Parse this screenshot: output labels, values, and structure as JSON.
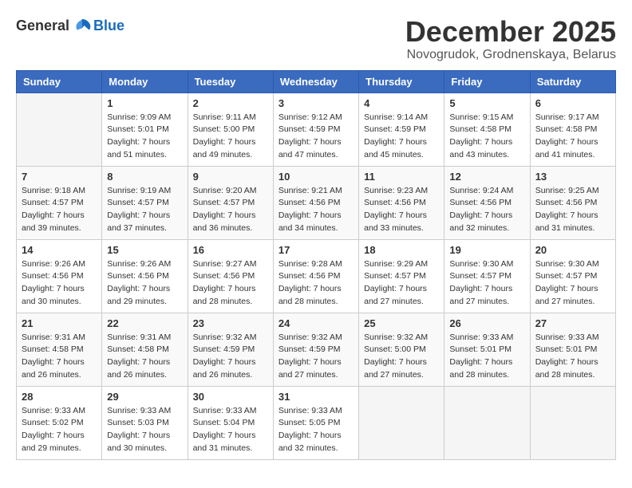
{
  "logo": {
    "general": "General",
    "blue": "Blue"
  },
  "header": {
    "month": "December 2025",
    "location": "Novogrudok, Grodnenskaya, Belarus"
  },
  "weekdays": [
    "Sunday",
    "Monday",
    "Tuesday",
    "Wednesday",
    "Thursday",
    "Friday",
    "Saturday"
  ],
  "weeks": [
    [
      {
        "day": "",
        "sunrise": "",
        "sunset": "",
        "daylight": ""
      },
      {
        "day": "1",
        "sunrise": "Sunrise: 9:09 AM",
        "sunset": "Sunset: 5:01 PM",
        "daylight": "Daylight: 7 hours and 51 minutes."
      },
      {
        "day": "2",
        "sunrise": "Sunrise: 9:11 AM",
        "sunset": "Sunset: 5:00 PM",
        "daylight": "Daylight: 7 hours and 49 minutes."
      },
      {
        "day": "3",
        "sunrise": "Sunrise: 9:12 AM",
        "sunset": "Sunset: 4:59 PM",
        "daylight": "Daylight: 7 hours and 47 minutes."
      },
      {
        "day": "4",
        "sunrise": "Sunrise: 9:14 AM",
        "sunset": "Sunset: 4:59 PM",
        "daylight": "Daylight: 7 hours and 45 minutes."
      },
      {
        "day": "5",
        "sunrise": "Sunrise: 9:15 AM",
        "sunset": "Sunset: 4:58 PM",
        "daylight": "Daylight: 7 hours and 43 minutes."
      },
      {
        "day": "6",
        "sunrise": "Sunrise: 9:17 AM",
        "sunset": "Sunset: 4:58 PM",
        "daylight": "Daylight: 7 hours and 41 minutes."
      }
    ],
    [
      {
        "day": "7",
        "sunrise": "Sunrise: 9:18 AM",
        "sunset": "Sunset: 4:57 PM",
        "daylight": "Daylight: 7 hours and 39 minutes."
      },
      {
        "day": "8",
        "sunrise": "Sunrise: 9:19 AM",
        "sunset": "Sunset: 4:57 PM",
        "daylight": "Daylight: 7 hours and 37 minutes."
      },
      {
        "day": "9",
        "sunrise": "Sunrise: 9:20 AM",
        "sunset": "Sunset: 4:57 PM",
        "daylight": "Daylight: 7 hours and 36 minutes."
      },
      {
        "day": "10",
        "sunrise": "Sunrise: 9:21 AM",
        "sunset": "Sunset: 4:56 PM",
        "daylight": "Daylight: 7 hours and 34 minutes."
      },
      {
        "day": "11",
        "sunrise": "Sunrise: 9:23 AM",
        "sunset": "Sunset: 4:56 PM",
        "daylight": "Daylight: 7 hours and 33 minutes."
      },
      {
        "day": "12",
        "sunrise": "Sunrise: 9:24 AM",
        "sunset": "Sunset: 4:56 PM",
        "daylight": "Daylight: 7 hours and 32 minutes."
      },
      {
        "day": "13",
        "sunrise": "Sunrise: 9:25 AM",
        "sunset": "Sunset: 4:56 PM",
        "daylight": "Daylight: 7 hours and 31 minutes."
      }
    ],
    [
      {
        "day": "14",
        "sunrise": "Sunrise: 9:26 AM",
        "sunset": "Sunset: 4:56 PM",
        "daylight": "Daylight: 7 hours and 30 minutes."
      },
      {
        "day": "15",
        "sunrise": "Sunrise: 9:26 AM",
        "sunset": "Sunset: 4:56 PM",
        "daylight": "Daylight: 7 hours and 29 minutes."
      },
      {
        "day": "16",
        "sunrise": "Sunrise: 9:27 AM",
        "sunset": "Sunset: 4:56 PM",
        "daylight": "Daylight: 7 hours and 28 minutes."
      },
      {
        "day": "17",
        "sunrise": "Sunrise: 9:28 AM",
        "sunset": "Sunset: 4:56 PM",
        "daylight": "Daylight: 7 hours and 28 minutes."
      },
      {
        "day": "18",
        "sunrise": "Sunrise: 9:29 AM",
        "sunset": "Sunset: 4:57 PM",
        "daylight": "Daylight: 7 hours and 27 minutes."
      },
      {
        "day": "19",
        "sunrise": "Sunrise: 9:30 AM",
        "sunset": "Sunset: 4:57 PM",
        "daylight": "Daylight: 7 hours and 27 minutes."
      },
      {
        "day": "20",
        "sunrise": "Sunrise: 9:30 AM",
        "sunset": "Sunset: 4:57 PM",
        "daylight": "Daylight: 7 hours and 27 minutes."
      }
    ],
    [
      {
        "day": "21",
        "sunrise": "Sunrise: 9:31 AM",
        "sunset": "Sunset: 4:58 PM",
        "daylight": "Daylight: 7 hours and 26 minutes."
      },
      {
        "day": "22",
        "sunrise": "Sunrise: 9:31 AM",
        "sunset": "Sunset: 4:58 PM",
        "daylight": "Daylight: 7 hours and 26 minutes."
      },
      {
        "day": "23",
        "sunrise": "Sunrise: 9:32 AM",
        "sunset": "Sunset: 4:59 PM",
        "daylight": "Daylight: 7 hours and 26 minutes."
      },
      {
        "day": "24",
        "sunrise": "Sunrise: 9:32 AM",
        "sunset": "Sunset: 4:59 PM",
        "daylight": "Daylight: 7 hours and 27 minutes."
      },
      {
        "day": "25",
        "sunrise": "Sunrise: 9:32 AM",
        "sunset": "Sunset: 5:00 PM",
        "daylight": "Daylight: 7 hours and 27 minutes."
      },
      {
        "day": "26",
        "sunrise": "Sunrise: 9:33 AM",
        "sunset": "Sunset: 5:01 PM",
        "daylight": "Daylight: 7 hours and 28 minutes."
      },
      {
        "day": "27",
        "sunrise": "Sunrise: 9:33 AM",
        "sunset": "Sunset: 5:01 PM",
        "daylight": "Daylight: 7 hours and 28 minutes."
      }
    ],
    [
      {
        "day": "28",
        "sunrise": "Sunrise: 9:33 AM",
        "sunset": "Sunset: 5:02 PM",
        "daylight": "Daylight: 7 hours and 29 minutes."
      },
      {
        "day": "29",
        "sunrise": "Sunrise: 9:33 AM",
        "sunset": "Sunset: 5:03 PM",
        "daylight": "Daylight: 7 hours and 30 minutes."
      },
      {
        "day": "30",
        "sunrise": "Sunrise: 9:33 AM",
        "sunset": "Sunset: 5:04 PM",
        "daylight": "Daylight: 7 hours and 31 minutes."
      },
      {
        "day": "31",
        "sunrise": "Sunrise: 9:33 AM",
        "sunset": "Sunset: 5:05 PM",
        "daylight": "Daylight: 7 hours and 32 minutes."
      },
      {
        "day": "",
        "sunrise": "",
        "sunset": "",
        "daylight": ""
      },
      {
        "day": "",
        "sunrise": "",
        "sunset": "",
        "daylight": ""
      },
      {
        "day": "",
        "sunrise": "",
        "sunset": "",
        "daylight": ""
      }
    ]
  ]
}
